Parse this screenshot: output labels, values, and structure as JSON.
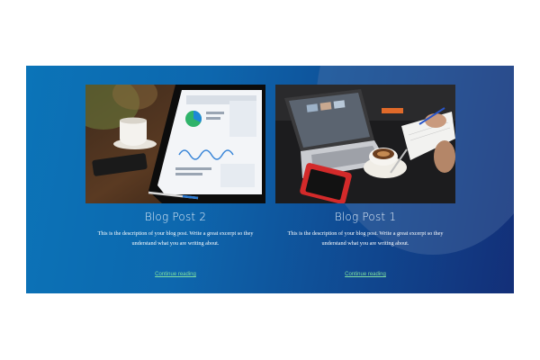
{
  "posts": [
    {
      "title": "Blog Post 2",
      "description": "This is the description of your blog post. Write a great excerpt so they understand what you are writing about.",
      "link_label": "Continue reading",
      "image_alt": "tablet-analytics-dashboard-photo"
    },
    {
      "title": "Blog Post 1",
      "description": "This is the description of your blog post. Write a great excerpt so they understand what you are writing about.",
      "link_label": "Continue reading",
      "image_alt": "laptop-coffee-desk-photo"
    }
  ],
  "colors": {
    "section_gradient_start": "#0b74b8",
    "section_gradient_end": "#132f78",
    "link": "#7fe0a0",
    "title": "#e6f0fa"
  }
}
